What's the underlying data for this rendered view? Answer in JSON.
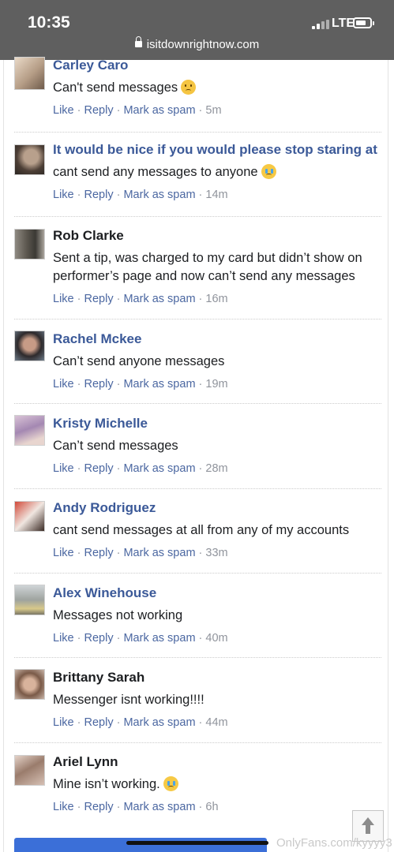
{
  "status_bar": {
    "time": "10:35",
    "network": "LTE",
    "url": "isitdownrightnow.com"
  },
  "comments": [
    {
      "author": "Carley Caro",
      "author_linked": true,
      "text": "Can't send messages",
      "emoji": "sad-face",
      "actions": {
        "like": "Like",
        "reply": "Reply",
        "spam": "Mark as spam",
        "time": "5m"
      }
    },
    {
      "author": "It would be nice if you would please stop staring at",
      "author_linked": true,
      "text": "cant send any messages to anyone",
      "emoji": "teary-face",
      "actions": {
        "like": "Like",
        "reply": "Reply",
        "spam": "Mark as spam",
        "time": "14m"
      }
    },
    {
      "author": "Rob Clarke",
      "author_linked": false,
      "text": "Sent a tip, was charged to my card but didn’t show on performer’s page and now can’t send any messages",
      "emoji": "",
      "actions": {
        "like": "Like",
        "reply": "Reply",
        "spam": "Mark as spam",
        "time": "16m"
      }
    },
    {
      "author": "Rachel Mckee",
      "author_linked": true,
      "text": "Can’t send anyone messages",
      "emoji": "",
      "actions": {
        "like": "Like",
        "reply": "Reply",
        "spam": "Mark as spam",
        "time": "19m"
      }
    },
    {
      "author": "Kristy Michelle",
      "author_linked": true,
      "text": "Can’t send messages",
      "emoji": "",
      "actions": {
        "like": "Like",
        "reply": "Reply",
        "spam": "Mark as spam",
        "time": "28m"
      }
    },
    {
      "author": "Andy Rodriguez",
      "author_linked": true,
      "text": "cant send messages at all from any of my accounts",
      "emoji": "",
      "actions": {
        "like": "Like",
        "reply": "Reply",
        "spam": "Mark as spam",
        "time": "33m"
      }
    },
    {
      "author": "Alex Winehouse",
      "author_linked": true,
      "text": "Messages not working",
      "emoji": "",
      "actions": {
        "like": "Like",
        "reply": "Reply",
        "spam": "Mark as spam",
        "time": "40m"
      }
    },
    {
      "author": "Brittany Sarah",
      "author_linked": false,
      "text": "Messenger isnt working!!!!",
      "emoji": "",
      "actions": {
        "like": "Like",
        "reply": "Reply",
        "spam": "Mark as spam",
        "time": "44m"
      }
    },
    {
      "author": "Ariel Lynn",
      "author_linked": false,
      "text": "Mine isn’t working.",
      "emoji": "crying-face",
      "actions": {
        "like": "Like",
        "reply": "Reply",
        "spam": "Mark as spam",
        "time": "6h"
      }
    }
  ],
  "watermark": "OnlyFans.com/kyyyy3",
  "colors": {
    "status_bar": "#5f5f5f",
    "link": "#3b5998",
    "action": "#4b67a1",
    "meta": "#90949c",
    "bottom_button": "#3b6fd8"
  }
}
